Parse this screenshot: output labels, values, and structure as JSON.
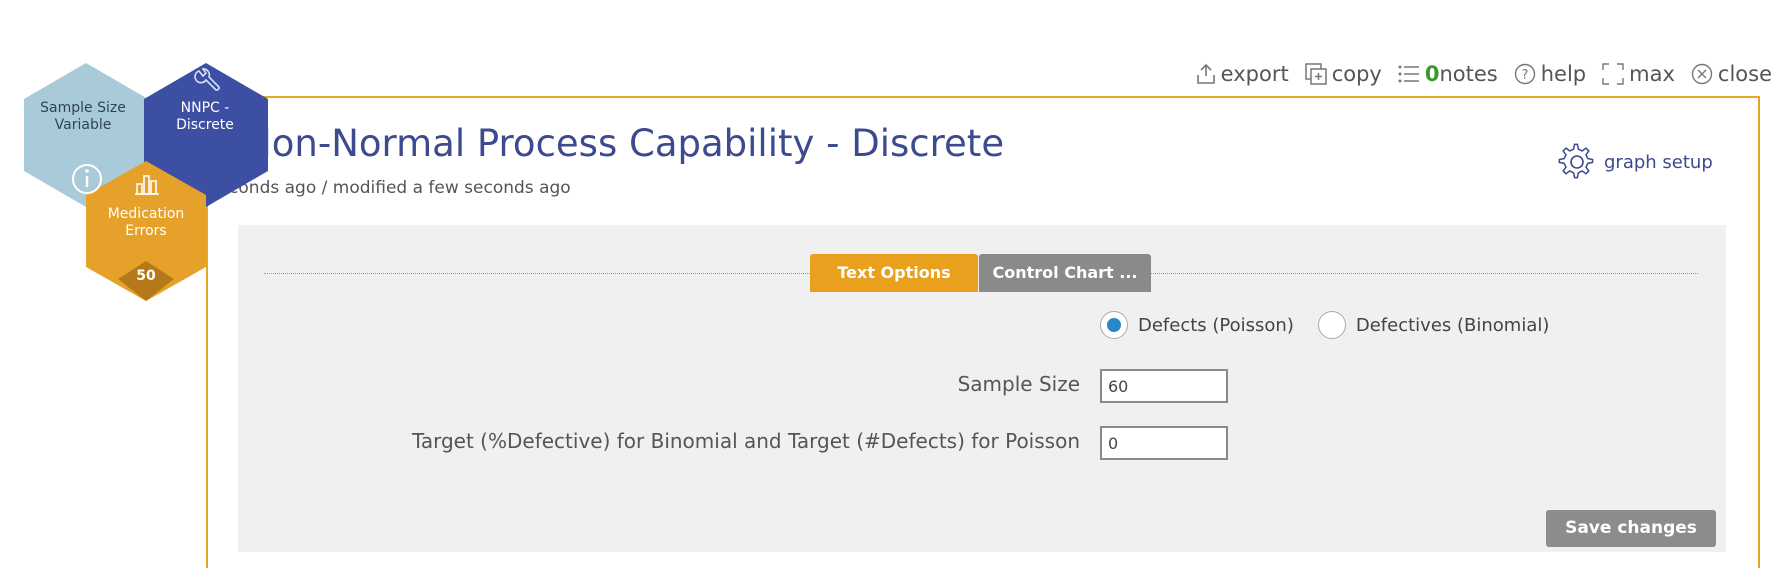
{
  "toolbar": {
    "export": "export",
    "copy": "copy",
    "notes_count": "0",
    "notes": "notes",
    "help": "help",
    "max": "max",
    "close": "close"
  },
  "hexes": {
    "sample_size": "Sample Size Variable",
    "nnpc": "NNPC - Discrete",
    "medication": "Medication Errors",
    "medication_count": "50"
  },
  "header": {
    "title": "Untitled Non-Normal Process Capability - Discrete",
    "subtitle": "created a few seconds ago / modified a few seconds ago",
    "graph_setup": "graph setup"
  },
  "tabs": {
    "text_options": "Text Options",
    "control_chart": "Control Chart ..."
  },
  "form": {
    "radio_defects": "Defects (Poisson)",
    "radio_defectives": "Defectives (Binomial)",
    "sample_size_label": "Sample Size",
    "sample_size_value": "60",
    "target_label": "Target (%Defective) for Binomial and Target (#Defects) for Poisson",
    "target_value": "0",
    "save": "Save changes"
  },
  "colors": {
    "accent": "#e8a723",
    "title": "#3c4a8e",
    "hex_blue_light": "#a9cbd9",
    "hex_blue_dark": "#3d4fa3",
    "hex_orange": "#e6a12a",
    "radio_selected": "#2a88c8"
  }
}
